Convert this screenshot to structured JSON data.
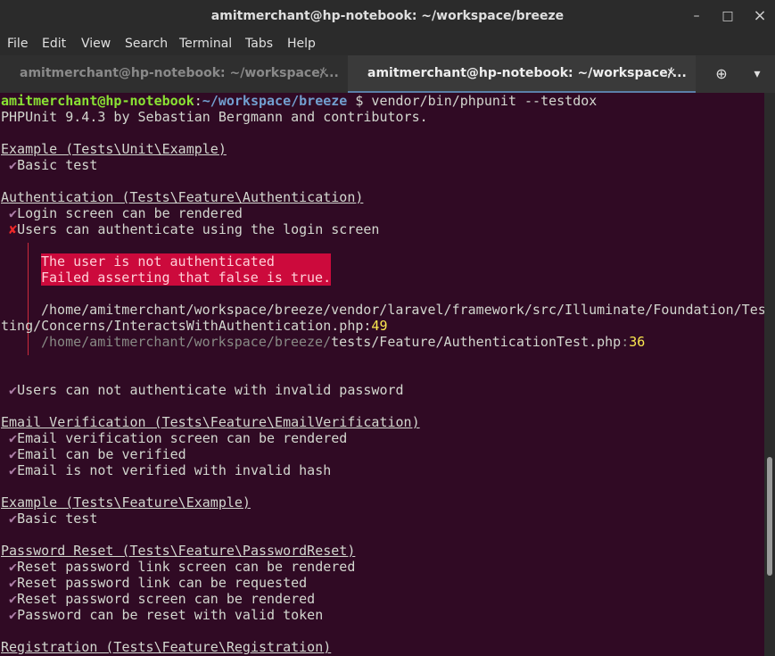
{
  "window": {
    "title": "amitmerchant@hp-notebook: ~/workspace/breeze",
    "minimize": "–",
    "maximize": "□",
    "close": "×"
  },
  "menu": [
    "File",
    "Edit",
    "View",
    "Search",
    "Terminal",
    "Tabs",
    "Help"
  ],
  "tabs": [
    {
      "label": "amitmerchant@hp-notebook: ~/workspace/...",
      "close": "×"
    },
    {
      "label": "amitmerchant@hp-notebook: ~/workspace/...",
      "close": "×"
    }
  ],
  "toolbar": {
    "new_tab_icon": "⊕",
    "menu_icon": "▾"
  },
  "terminal": {
    "prompt_user": "amitmerchant@hp-notebook",
    "prompt_sep": ":",
    "prompt_path": "~/workspace/breeze",
    "prompt_cmd": " $ vendor/bin/phpunit --testdox",
    "version": "PHPUnit 9.4.3 by Sebastian Bergmann and contributors.",
    "check": "✔",
    "cross": "✘",
    "s1_title": "Example (Tests\\Unit\\Example)",
    "s1_t1": "Basic test",
    "s2_title": "Authentication (Tests\\Feature\\Authentication)",
    "s2_t1": "Login screen can be rendered",
    "s2_t2": "Users can authenticate using the login screen",
    "err1": "The user is not authenticated",
    "err2": "Failed asserting that false is true.",
    "trace1a": "/home/amitmerchant/workspace/breeze/vendor/laravel/framework/src/Illuminate/Foundation/Tes",
    "trace1b": "ting/Concerns/InteractsWithAuthentication.php",
    "trace1_colon": ":",
    "trace1_line": "49",
    "trace2_path": "/home/amitmerchant/workspace/breeze/",
    "trace2_file": "tests/Feature/AuthenticationTest.php",
    "trace2_colon": ":",
    "trace2_line": "36",
    "s2_t3": "Users can not authenticate with invalid password",
    "s3_title": "Email Verification (Tests\\Feature\\EmailVerification)",
    "s3_t1": "Email verification screen can be rendered",
    "s3_t2": "Email can be verified",
    "s3_t3": "Email is not verified with invalid hash",
    "s4_title": "Example (Tests\\Feature\\Example)",
    "s4_t1": "Basic test",
    "s5_title": "Password Reset (Tests\\Feature\\PasswordReset)",
    "s5_t1": "Reset password link screen can be rendered",
    "s5_t2": "Reset password link can be requested",
    "s5_t3": "Reset password screen can be rendered",
    "s5_t4": "Password can be reset with valid token",
    "s6_title": "Registration (Tests\\Feature\\Registration)"
  }
}
